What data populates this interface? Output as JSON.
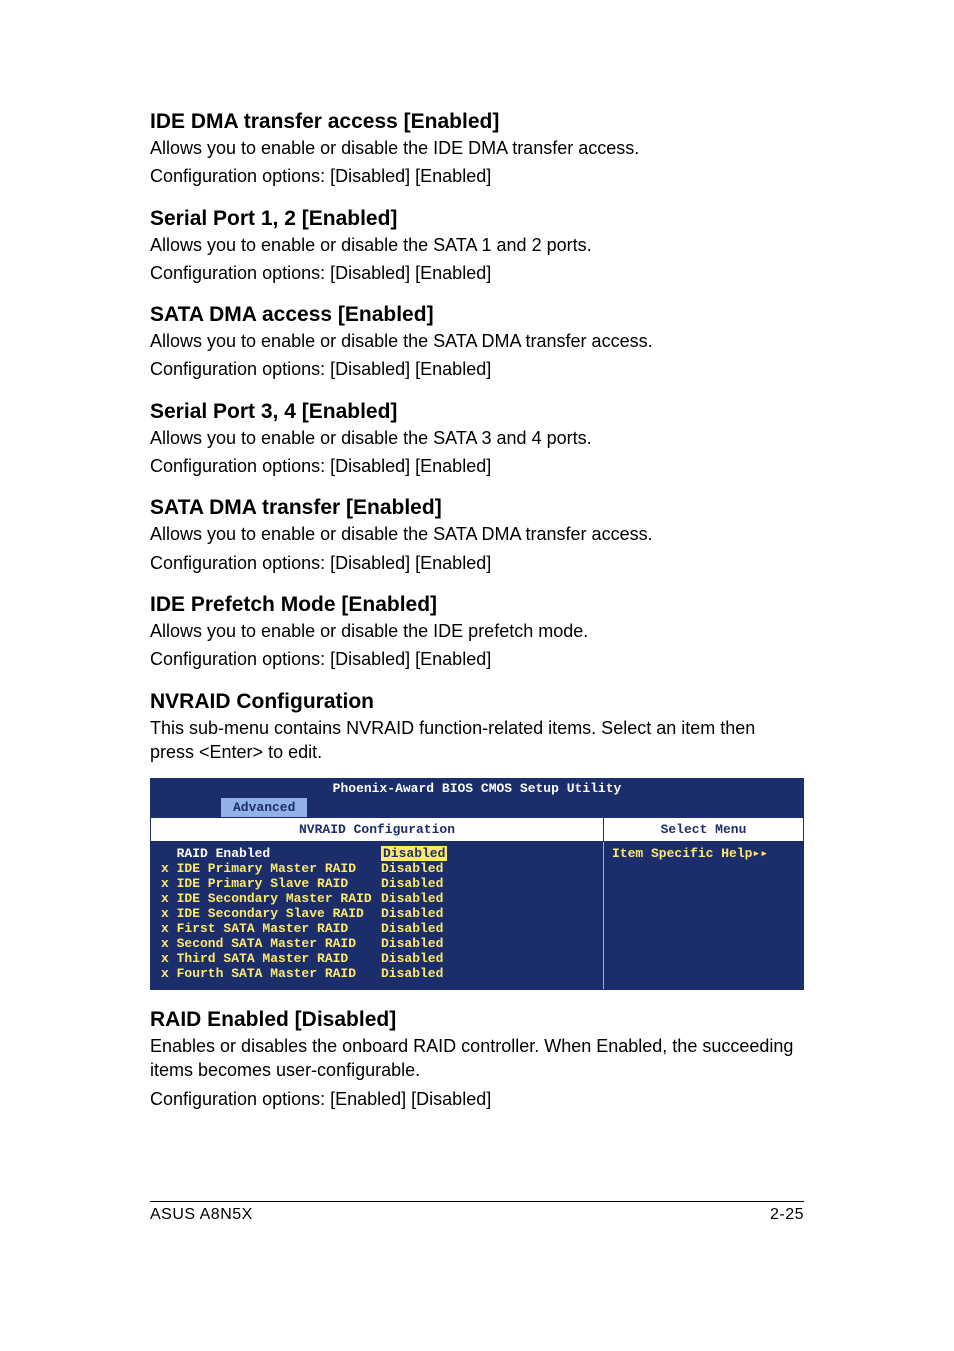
{
  "sections": {
    "s1": {
      "heading": "IDE DMA transfer access [Enabled]",
      "l1": "Allows you to enable or disable the IDE DMA transfer access.",
      "l2": "Configuration options: [Disabled] [Enabled]"
    },
    "s2": {
      "heading": "Serial Port 1, 2 [Enabled]",
      "l1": "Allows you to enable or disable the SATA 1 and 2 ports.",
      "l2": "Configuration options: [Disabled] [Enabled]"
    },
    "s3": {
      "heading": "SATA DMA access [Enabled]",
      "l1": "Allows you to enable or disable the SATA DMA transfer access.",
      "l2": "Configuration options: [Disabled] [Enabled]"
    },
    "s4": {
      "heading": "Serial Port 3, 4 [Enabled]",
      "l1": "Allows you to enable or disable the SATA 3 and 4 ports.",
      "l2": "Configuration options: [Disabled] [Enabled]"
    },
    "s5": {
      "heading": "SATA DMA transfer [Enabled]",
      "l1": "Allows you to enable or disable the SATA DMA transfer access.",
      "l2": "Configuration options: [Disabled] [Enabled]"
    },
    "s6": {
      "heading": "IDE Prefetch Mode [Enabled]",
      "l1": "Allows you to enable or disable the IDE prefetch mode.",
      "l2": "Configuration options: [Disabled] [Enabled]"
    },
    "s7": {
      "heading": "NVRAID Configuration",
      "l1": "This sub-menu contains NVRAID function-related items. Select an item then press <Enter> to edit."
    },
    "s8": {
      "heading": "RAID Enabled [Disabled]",
      "l1": "Enables or disables the onboard RAID controller. When Enabled, the succeeding items becomes user-configurable.",
      "l2": "Configuration options: [Enabled] [Disabled]"
    }
  },
  "bios": {
    "title": "Phoenix-Award BIOS CMOS Setup Utility",
    "tab": "Advanced",
    "left_heading": "NVRAID Configuration",
    "right_heading": "Select Menu",
    "help_text": "Item Specific Help▸▸",
    "items": {
      "i0": {
        "label": "  RAID Enabled",
        "value": "Disabled"
      },
      "i1": {
        "label": "x IDE Primary Master RAID",
        "value": "Disabled"
      },
      "i2": {
        "label": "x IDE Primary Slave RAID",
        "value": "Disabled"
      },
      "i3": {
        "label": "x IDE Secondary Master RAID",
        "value": "Disabled"
      },
      "i4": {
        "label": "x IDE Secondary Slave RAID",
        "value": "Disabled"
      },
      "i5": {
        "label": "x First SATA Master RAID",
        "value": "Disabled"
      },
      "i6": {
        "label": "x Second SATA Master RAID",
        "value": "Disabled"
      },
      "i7": {
        "label": "x Third SATA Master RAID",
        "value": "Disabled"
      },
      "i8": {
        "label": "x Fourth SATA Master RAID",
        "value": "Disabled"
      }
    }
  },
  "footer": {
    "left": "ASUS A8N5X",
    "right": "2-25"
  }
}
